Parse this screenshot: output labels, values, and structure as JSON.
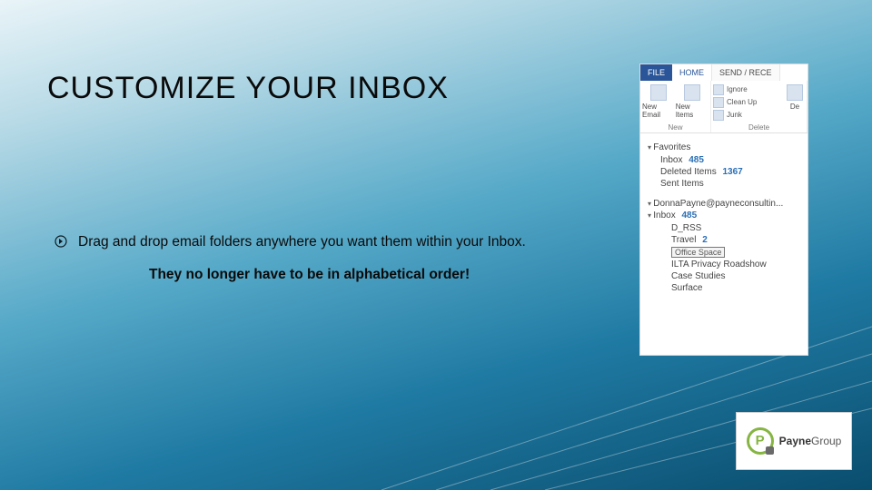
{
  "title": "CUSTOMIZE YOUR INBOX",
  "bullets": {
    "line1": "Drag and drop email folders anywhere you want them within your Inbox.",
    "line2": "They no longer have to be in alphabetical order!"
  },
  "outlook": {
    "tabs": {
      "file": "FILE",
      "home": "HOME",
      "send": "SEND / RECE"
    },
    "ribbon": {
      "group_new_label": "New",
      "new_email": "New Email",
      "new_items": "New Items",
      "group_delete_label": "Delete",
      "ignore": "Ignore",
      "cleanup": "Clean Up",
      "junk": "Junk",
      "del": "De"
    },
    "favorites": {
      "header": "Favorites",
      "inbox": "Inbox",
      "inbox_count": "485",
      "deleted": "Deleted Items",
      "deleted_count": "1367",
      "sent": "Sent Items"
    },
    "account": "DonnaPayne@payneconsultin...",
    "inbox_tree": {
      "header": "Inbox",
      "header_count": "485",
      "rss": "D_RSS",
      "travel": "Travel",
      "travel_count": "2",
      "drag_item": "Office Space",
      "ilta": "ILTA Privacy Roadshow",
      "cases": "Case Studies",
      "surface": "Surface"
    }
  },
  "logo": {
    "brand_a": "Payne",
    "brand_b": "Group"
  }
}
